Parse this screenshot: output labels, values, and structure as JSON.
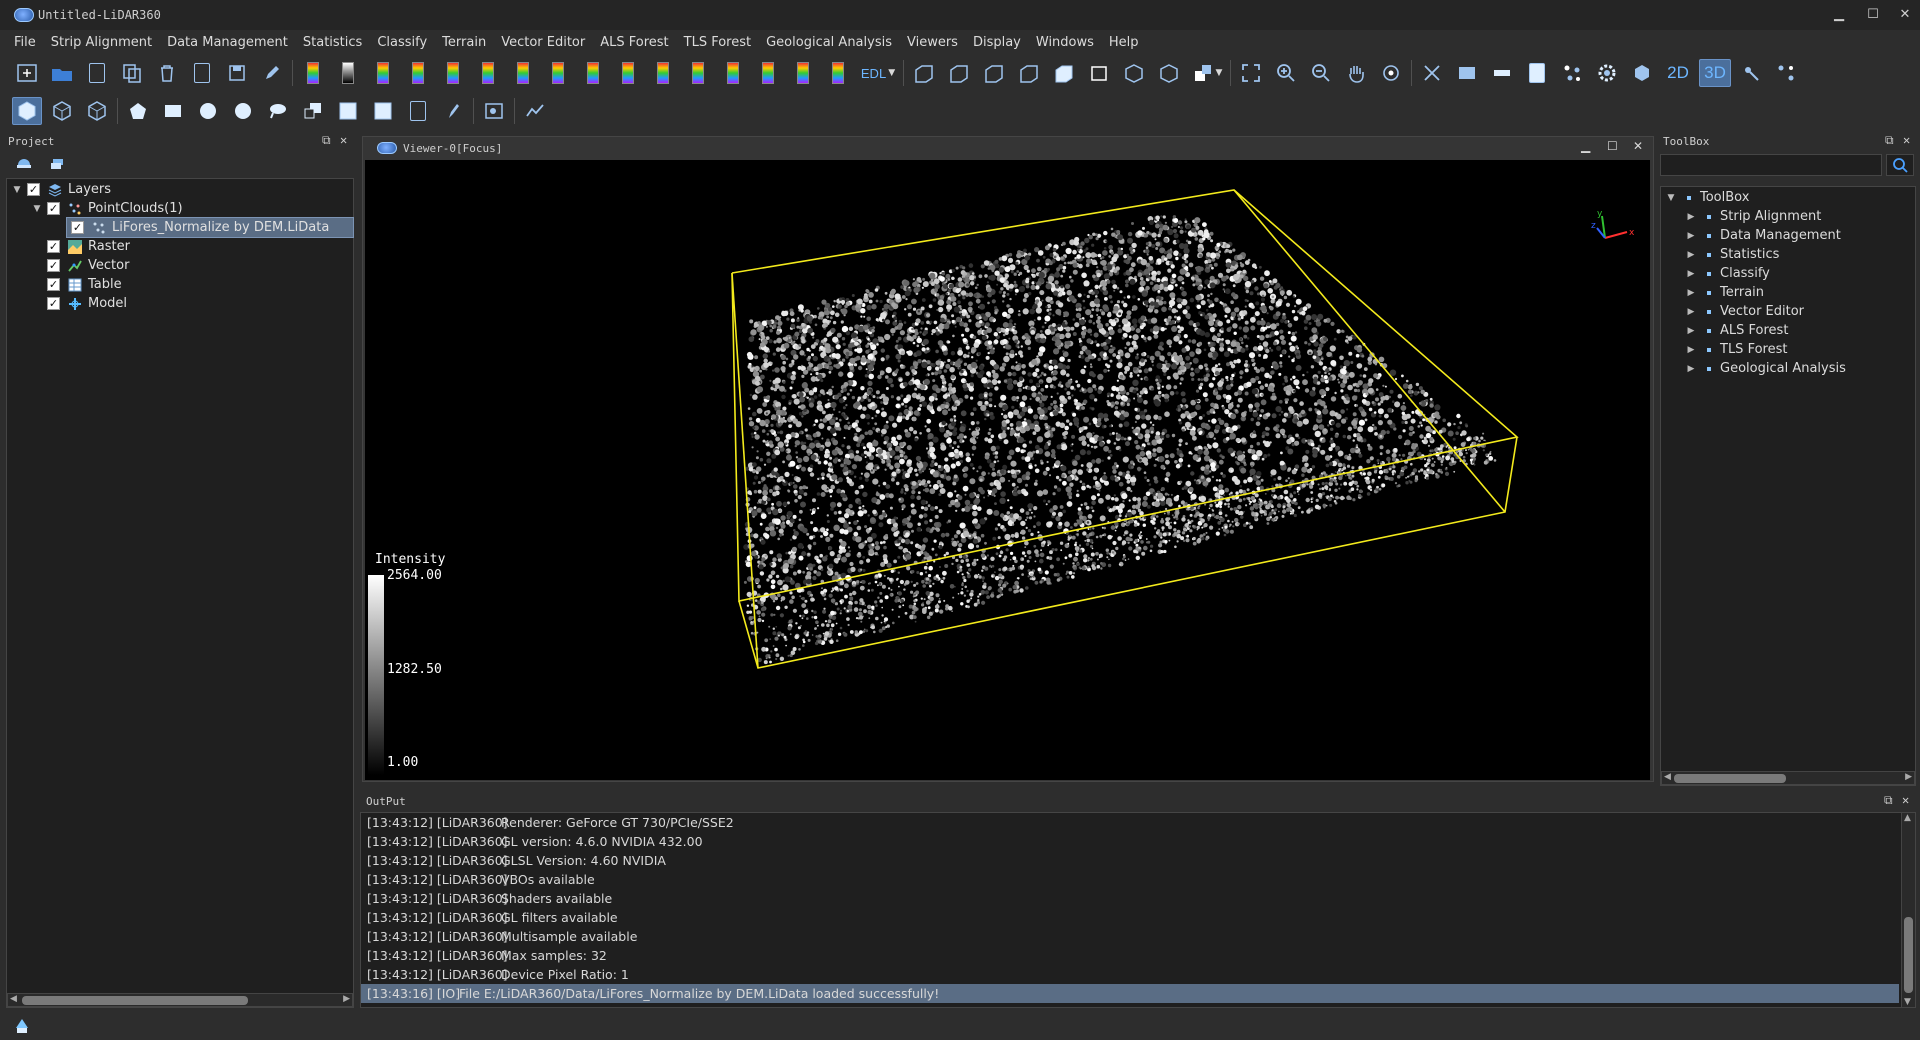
{
  "window": {
    "title": "Untitled-LiDAR360",
    "minimize": "▁",
    "maximize": "☐",
    "close": "✕"
  },
  "menu": [
    "File",
    "Strip Alignment",
    "Data Management",
    "Statistics",
    "Classify",
    "Terrain",
    "Vector Editor",
    "ALS Forest",
    "TLS Forest",
    "Geological Analysis",
    "Viewers",
    "Display",
    "Windows",
    "Help"
  ],
  "toolbar": {
    "edl_label": "EDL",
    "view_2d": "2D",
    "view_3d": "3D",
    "active_view": "3D"
  },
  "project": {
    "title": "Project",
    "tree": [
      {
        "label": "Layers",
        "checked": true,
        "icon": "layers-icon"
      },
      {
        "label": "PointClouds(1)",
        "checked": true,
        "icon": "pointcloud-icon"
      },
      {
        "label": "LiFores_Normalize by DEM.LiData",
        "checked": true,
        "icon": "pointcloud-file-icon",
        "selected": true
      },
      {
        "label": "Raster",
        "checked": true,
        "icon": "raster-icon"
      },
      {
        "label": "Vector",
        "checked": true,
        "icon": "vector-icon"
      },
      {
        "label": "Table",
        "checked": true,
        "icon": "table-icon"
      },
      {
        "label": "Model",
        "checked": true,
        "icon": "model-icon"
      }
    ]
  },
  "viewer": {
    "title": "Viewer-0[Focus]",
    "legend": {
      "title": "Intensity",
      "max": "2564.00",
      "mid": "1282.50",
      "min": "1.00"
    },
    "axis_labels": {
      "x": "x",
      "y": "y",
      "z": "z"
    }
  },
  "toolbox": {
    "title": "ToolBox",
    "search_placeholder": "",
    "root": "ToolBox",
    "items": [
      "Strip Alignment",
      "Data Management",
      "Statistics",
      "Classify",
      "Terrain",
      "Vector Editor",
      "ALS Forest",
      "TLS Forest",
      "Geological Analysis"
    ]
  },
  "output": {
    "title": "OutPut",
    "lines": [
      {
        "ts": "[13:43:12] [LiDAR360]",
        "msg": "Renderer: GeForce GT 730/PCIe/SSE2"
      },
      {
        "ts": "[13:43:12] [LiDAR360]",
        "msg": "GL version: 4.6.0 NVIDIA 432.00"
      },
      {
        "ts": "[13:43:12] [LiDAR360]",
        "msg": "GLSL Version: 4.60 NVIDIA"
      },
      {
        "ts": "[13:43:12] [LiDAR360]",
        "msg": "VBOs available"
      },
      {
        "ts": "[13:43:12] [LiDAR360]",
        "msg": "Shaders available"
      },
      {
        "ts": "[13:43:12] [LiDAR360]",
        "msg": "GL filters available"
      },
      {
        "ts": "[13:43:12] [LiDAR360]",
        "msg": "Multisample available"
      },
      {
        "ts": "[13:43:12] [LiDAR360]",
        "msg": "Max samples: 32"
      },
      {
        "ts": "[13:43:12] [LiDAR360]",
        "msg": "Device Pixel Ratio: 1"
      },
      {
        "ts": "[13:43:16] [IO]",
        "msg": "File E:/LiDAR360/Data/LiFores_Normalize by DEM.LiData loaded successfully!"
      }
    ]
  }
}
